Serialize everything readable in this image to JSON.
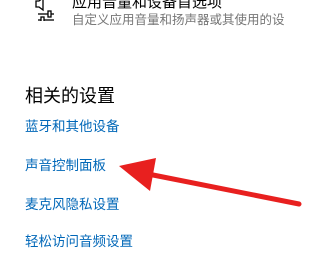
{
  "top_entry": {
    "title": "应用音量和设备首选项",
    "description": "自定义应用音量和扬声器或其使用的设",
    "icon": "volume-mixer-icon"
  },
  "related_settings": {
    "heading": "相关的设置",
    "links": [
      {
        "label": "蓝牙和其他设备"
      },
      {
        "label": "声音控制面板"
      },
      {
        "label": "麦克风隐私设置"
      },
      {
        "label": "轻松访问音频设置"
      }
    ]
  },
  "annotation": {
    "arrow_color": "#e8201f",
    "points_to": "声音控制面板"
  },
  "colors": {
    "link": "#0067b8",
    "description": "#767676"
  }
}
